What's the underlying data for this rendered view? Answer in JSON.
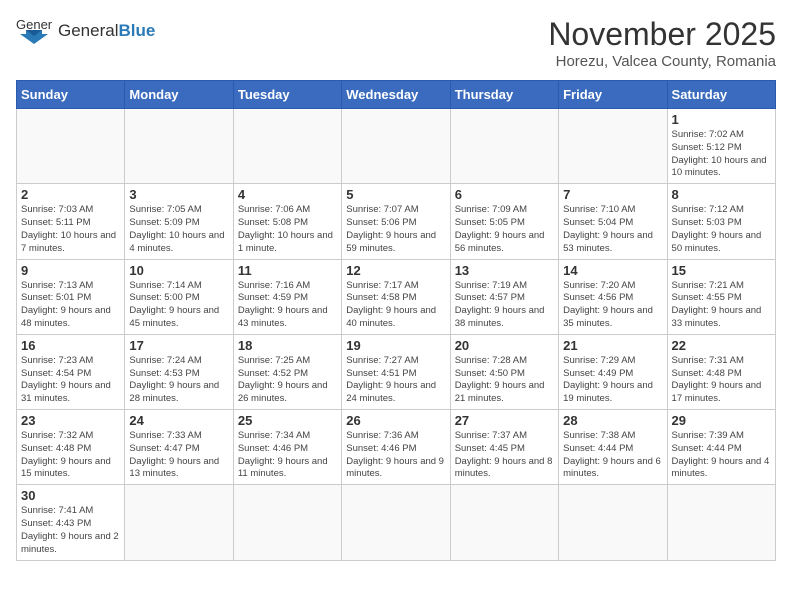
{
  "header": {
    "logo_general": "General",
    "logo_blue": "Blue",
    "title": "November 2025",
    "subtitle": "Horezu, Valcea County, Romania"
  },
  "weekdays": [
    "Sunday",
    "Monday",
    "Tuesday",
    "Wednesday",
    "Thursday",
    "Friday",
    "Saturday"
  ],
  "days": [
    {
      "date": "",
      "info": ""
    },
    {
      "date": "",
      "info": ""
    },
    {
      "date": "",
      "info": ""
    },
    {
      "date": "",
      "info": ""
    },
    {
      "date": "",
      "info": ""
    },
    {
      "date": "",
      "info": ""
    },
    {
      "date": "1",
      "info": "Sunrise: 7:02 AM\nSunset: 5:12 PM\nDaylight: 10 hours and 10 minutes."
    },
    {
      "date": "2",
      "info": "Sunrise: 7:03 AM\nSunset: 5:11 PM\nDaylight: 10 hours and 7 minutes."
    },
    {
      "date": "3",
      "info": "Sunrise: 7:05 AM\nSunset: 5:09 PM\nDaylight: 10 hours and 4 minutes."
    },
    {
      "date": "4",
      "info": "Sunrise: 7:06 AM\nSunset: 5:08 PM\nDaylight: 10 hours and 1 minute."
    },
    {
      "date": "5",
      "info": "Sunrise: 7:07 AM\nSunset: 5:06 PM\nDaylight: 9 hours and 59 minutes."
    },
    {
      "date": "6",
      "info": "Sunrise: 7:09 AM\nSunset: 5:05 PM\nDaylight: 9 hours and 56 minutes."
    },
    {
      "date": "7",
      "info": "Sunrise: 7:10 AM\nSunset: 5:04 PM\nDaylight: 9 hours and 53 minutes."
    },
    {
      "date": "8",
      "info": "Sunrise: 7:12 AM\nSunset: 5:03 PM\nDaylight: 9 hours and 50 minutes."
    },
    {
      "date": "9",
      "info": "Sunrise: 7:13 AM\nSunset: 5:01 PM\nDaylight: 9 hours and 48 minutes."
    },
    {
      "date": "10",
      "info": "Sunrise: 7:14 AM\nSunset: 5:00 PM\nDaylight: 9 hours and 45 minutes."
    },
    {
      "date": "11",
      "info": "Sunrise: 7:16 AM\nSunset: 4:59 PM\nDaylight: 9 hours and 43 minutes."
    },
    {
      "date": "12",
      "info": "Sunrise: 7:17 AM\nSunset: 4:58 PM\nDaylight: 9 hours and 40 minutes."
    },
    {
      "date": "13",
      "info": "Sunrise: 7:19 AM\nSunset: 4:57 PM\nDaylight: 9 hours and 38 minutes."
    },
    {
      "date": "14",
      "info": "Sunrise: 7:20 AM\nSunset: 4:56 PM\nDaylight: 9 hours and 35 minutes."
    },
    {
      "date": "15",
      "info": "Sunrise: 7:21 AM\nSunset: 4:55 PM\nDaylight: 9 hours and 33 minutes."
    },
    {
      "date": "16",
      "info": "Sunrise: 7:23 AM\nSunset: 4:54 PM\nDaylight: 9 hours and 31 minutes."
    },
    {
      "date": "17",
      "info": "Sunrise: 7:24 AM\nSunset: 4:53 PM\nDaylight: 9 hours and 28 minutes."
    },
    {
      "date": "18",
      "info": "Sunrise: 7:25 AM\nSunset: 4:52 PM\nDaylight: 9 hours and 26 minutes."
    },
    {
      "date": "19",
      "info": "Sunrise: 7:27 AM\nSunset: 4:51 PM\nDaylight: 9 hours and 24 minutes."
    },
    {
      "date": "20",
      "info": "Sunrise: 7:28 AM\nSunset: 4:50 PM\nDaylight: 9 hours and 21 minutes."
    },
    {
      "date": "21",
      "info": "Sunrise: 7:29 AM\nSunset: 4:49 PM\nDaylight: 9 hours and 19 minutes."
    },
    {
      "date": "22",
      "info": "Sunrise: 7:31 AM\nSunset: 4:48 PM\nDaylight: 9 hours and 17 minutes."
    },
    {
      "date": "23",
      "info": "Sunrise: 7:32 AM\nSunset: 4:48 PM\nDaylight: 9 hours and 15 minutes."
    },
    {
      "date": "24",
      "info": "Sunrise: 7:33 AM\nSunset: 4:47 PM\nDaylight: 9 hours and 13 minutes."
    },
    {
      "date": "25",
      "info": "Sunrise: 7:34 AM\nSunset: 4:46 PM\nDaylight: 9 hours and 11 minutes."
    },
    {
      "date": "26",
      "info": "Sunrise: 7:36 AM\nSunset: 4:46 PM\nDaylight: 9 hours and 9 minutes."
    },
    {
      "date": "27",
      "info": "Sunrise: 7:37 AM\nSunset: 4:45 PM\nDaylight: 9 hours and 8 minutes."
    },
    {
      "date": "28",
      "info": "Sunrise: 7:38 AM\nSunset: 4:44 PM\nDaylight: 9 hours and 6 minutes."
    },
    {
      "date": "29",
      "info": "Sunrise: 7:39 AM\nSunset: 4:44 PM\nDaylight: 9 hours and 4 minutes."
    },
    {
      "date": "30",
      "info": "Sunrise: 7:41 AM\nSunset: 4:43 PM\nDaylight: 9 hours and 2 minutes."
    },
    {
      "date": "",
      "info": ""
    },
    {
      "date": "",
      "info": ""
    },
    {
      "date": "",
      "info": ""
    },
    {
      "date": "",
      "info": ""
    },
    {
      "date": "",
      "info": ""
    },
    {
      "date": "",
      "info": ""
    },
    {
      "date": "",
      "info": ""
    }
  ]
}
